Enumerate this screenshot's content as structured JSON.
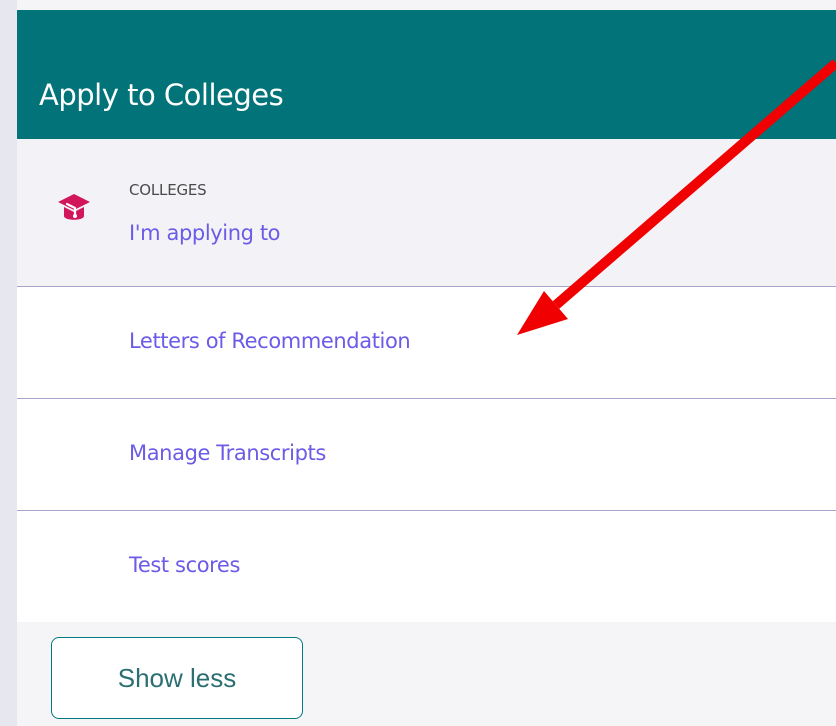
{
  "header": {
    "title": "Apply to Colleges",
    "background_color": "#017379"
  },
  "colleges_section": {
    "label": "COLLEGES",
    "link": "I'm applying to",
    "icon": "graduation-cap-icon",
    "icon_color": "#d1165c"
  },
  "menu_items": [
    {
      "label": "Letters of Recommendation"
    },
    {
      "label": "Manage Transcripts"
    },
    {
      "label": "Test scores"
    }
  ],
  "footer": {
    "button_label": "Show less"
  },
  "colors": {
    "link": "#6b5be6",
    "divider": "#a7a4c9",
    "annotation_arrow": "#f00000",
    "button_border": "#007a80"
  }
}
